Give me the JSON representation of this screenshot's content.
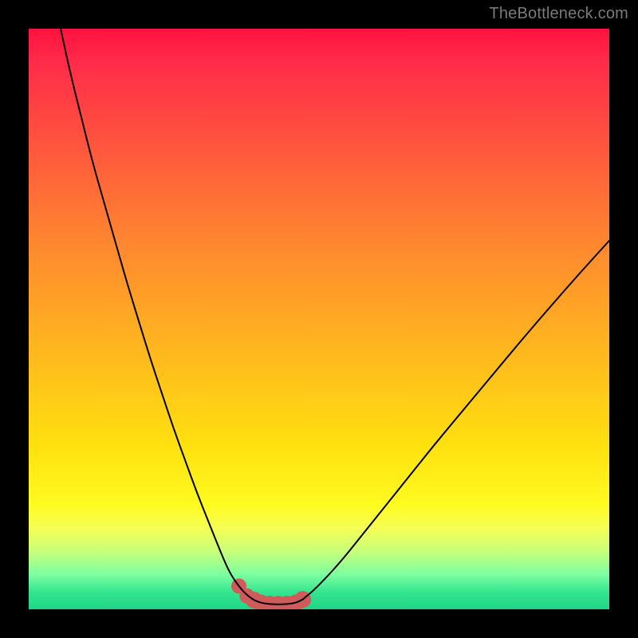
{
  "watermark": "TheBottleneck.com",
  "chart_data": {
    "type": "line",
    "title": "",
    "xlabel": "",
    "ylabel": "",
    "xlim": [
      0,
      100
    ],
    "ylim": [
      0,
      100
    ],
    "grid": false,
    "legend": false,
    "series": [
      {
        "name": "left-branch",
        "x": [
          5.5,
          7,
          9,
          11,
          13,
          15,
          17,
          19,
          21,
          23,
          25,
          27,
          29,
          31,
          33,
          34.5,
          36,
          37.5,
          38.8
        ],
        "y": [
          100,
          93,
          85,
          77,
          70,
          63,
          56,
          49.5,
          43,
          37,
          31,
          25.5,
          20,
          15,
          10,
          6.5,
          4.2,
          2.5,
          1.6
        ]
      },
      {
        "name": "valley-floor",
        "x": [
          38.8,
          40,
          41.5,
          43,
          44.5,
          46,
          47.2
        ],
        "y": [
          1.6,
          1.1,
          0.9,
          0.85,
          0.9,
          1.1,
          1.7
        ]
      },
      {
        "name": "right-branch",
        "x": [
          47.2,
          49,
          51,
          54,
          58,
          62,
          66,
          70,
          75,
          80,
          85,
          90,
          95,
          100
        ],
        "y": [
          1.7,
          3.2,
          5.2,
          8.5,
          13.5,
          18.5,
          23.5,
          28.5,
          34.5,
          40.5,
          46.5,
          52.3,
          58,
          63.5
        ]
      }
    ],
    "markers": {
      "name": "bottleneck-highlight",
      "color": "#cf5b5b",
      "x": [
        36.2,
        37.6,
        38.8,
        40.0,
        41.5,
        43.0,
        44.5,
        46.0,
        47.2
      ],
      "y": [
        4.0,
        2.3,
        1.6,
        1.1,
        0.9,
        0.85,
        0.9,
        1.1,
        1.7
      ],
      "r": [
        9,
        9,
        10,
        10,
        10,
        10,
        10,
        10,
        10
      ]
    },
    "gradient_stops": [
      {
        "pos": 0.0,
        "color": "#ff123f"
      },
      {
        "pos": 0.06,
        "color": "#ff2c49"
      },
      {
        "pos": 0.22,
        "color": "#ff5b3c"
      },
      {
        "pos": 0.38,
        "color": "#ff8a2e"
      },
      {
        "pos": 0.55,
        "color": "#ffb61f"
      },
      {
        "pos": 0.72,
        "color": "#ffe10f"
      },
      {
        "pos": 0.82,
        "color": "#fffb20"
      },
      {
        "pos": 0.86,
        "color": "#f5ff55"
      },
      {
        "pos": 0.9,
        "color": "#c8ff7a"
      },
      {
        "pos": 0.94,
        "color": "#7dffa0"
      },
      {
        "pos": 0.97,
        "color": "#35e58f"
      },
      {
        "pos": 1.0,
        "color": "#1fd688"
      }
    ]
  }
}
